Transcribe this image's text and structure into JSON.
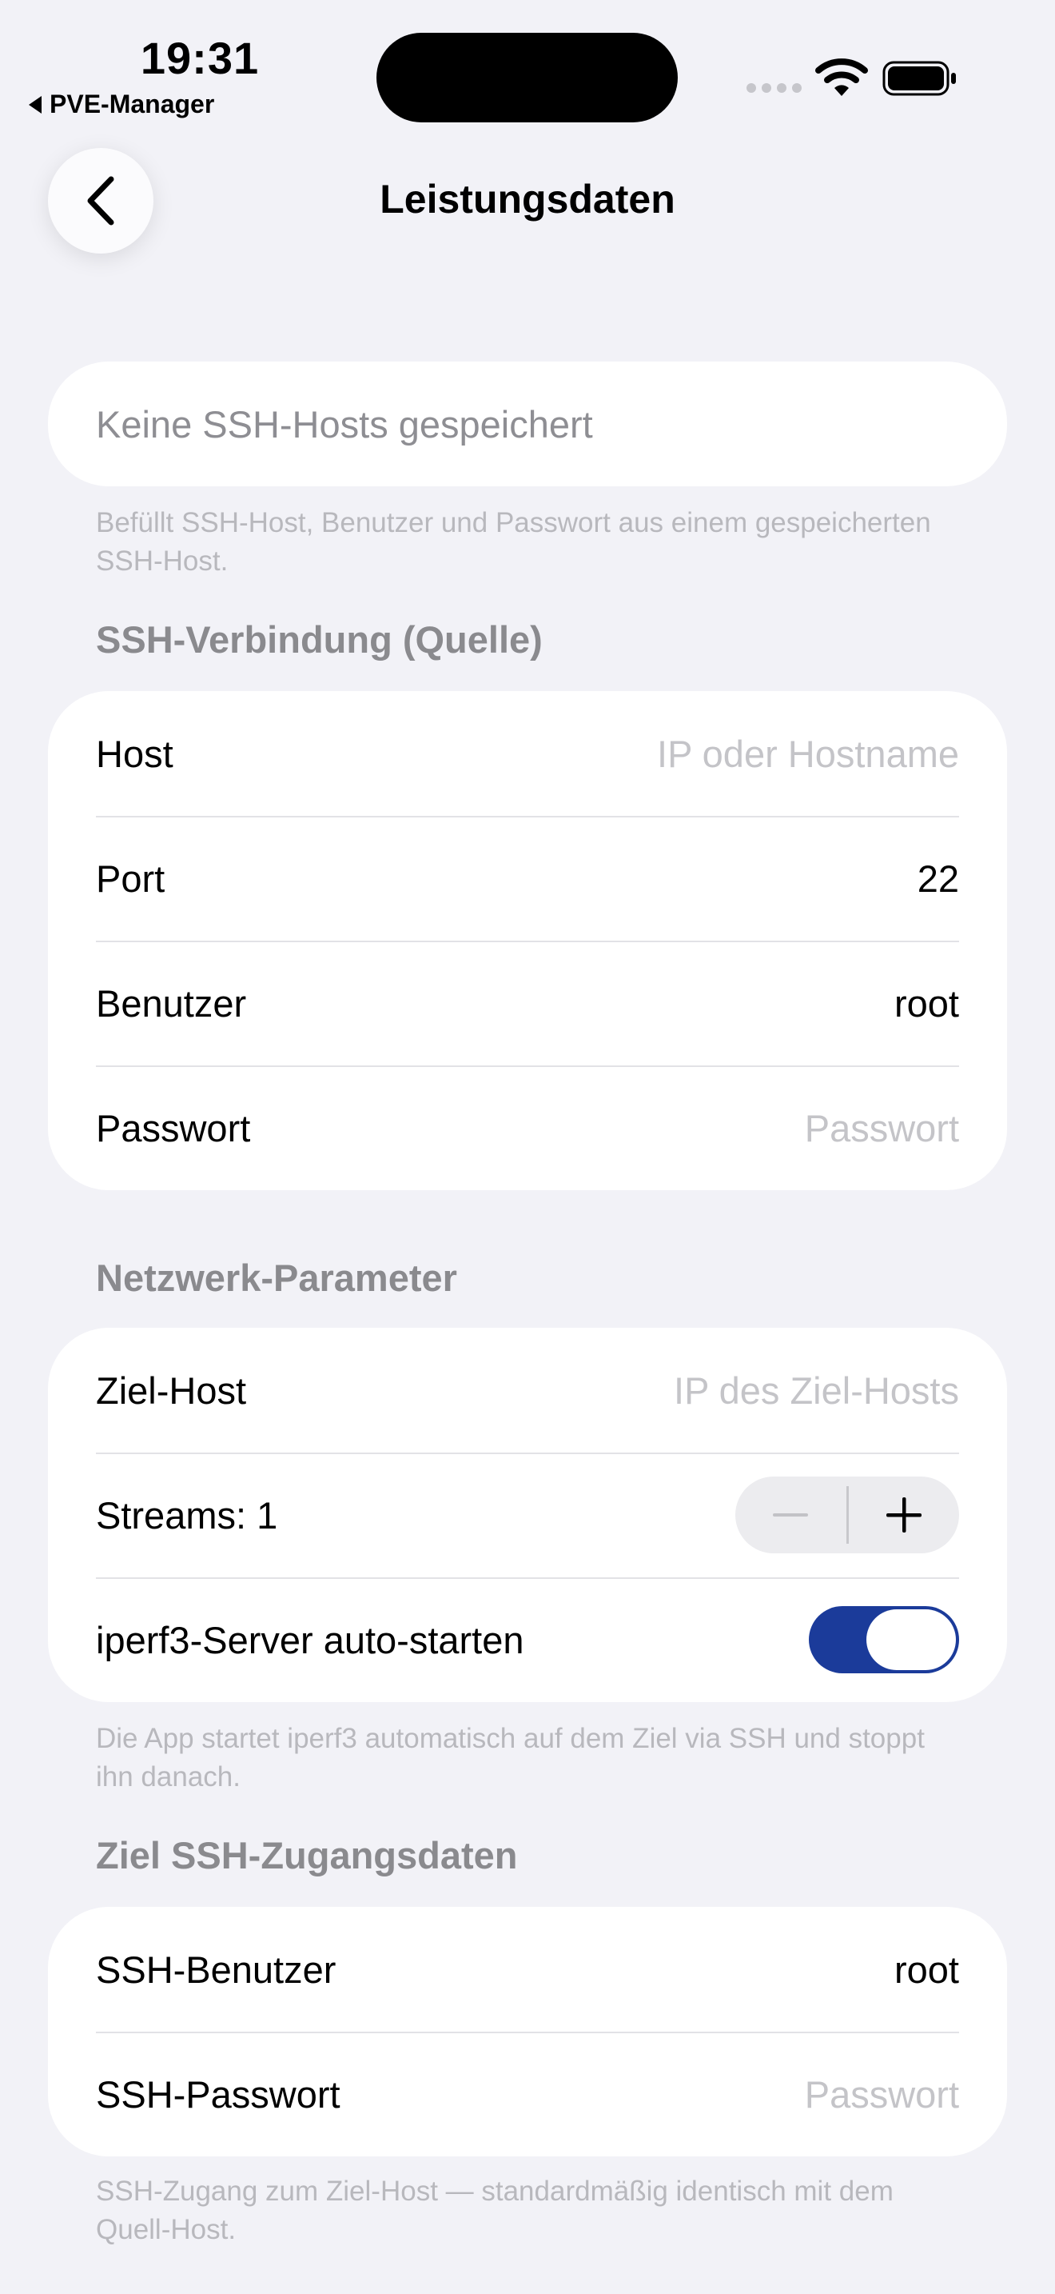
{
  "status_bar": {
    "time": "19:31",
    "back_app": "PVE-Manager"
  },
  "nav": {
    "title": "Leistungsdaten",
    "back_icon": "chevron-left-icon"
  },
  "ssh_host_picker": {
    "placeholder": "Keine SSH-Hosts gespeichert",
    "footer": "Befüllt SSH-Host, Benutzer und Passwort aus einem gespeicherten SSH-Host."
  },
  "source_connection": {
    "header": "SSH-Verbindung (Quelle)",
    "host": {
      "label": "Host",
      "placeholder": "IP oder Hostname"
    },
    "port": {
      "label": "Port",
      "value": "22"
    },
    "user": {
      "label": "Benutzer",
      "value": "root"
    },
    "password": {
      "label": "Passwort",
      "placeholder": "Passwort"
    }
  },
  "network": {
    "header": "Netzwerk-Parameter",
    "target_host": {
      "label": "Ziel-Host",
      "placeholder": "IP des Ziel-Hosts"
    },
    "streams": {
      "label": "Streams: 1",
      "value": 1
    },
    "autostart": {
      "label": "iperf3-Server auto-starten",
      "enabled": true
    },
    "footer": "Die App startet iperf3 automatisch auf dem Ziel via SSH und stoppt ihn danach."
  },
  "target_credentials": {
    "header": "Ziel SSH-Zugangsdaten",
    "user": {
      "label": "SSH-Benutzer",
      "value": "root"
    },
    "password": {
      "label": "SSH-Passwort",
      "placeholder": "Passwort"
    },
    "footer": "SSH-Zugang zum Ziel-Host — standardmäßig identisch mit dem Quell-Host."
  },
  "colors": {
    "background": "#f2f2f7",
    "toggle_on": "#1b3b9a",
    "placeholder": "#c4c4c8",
    "section_header": "#8a8a8e"
  }
}
